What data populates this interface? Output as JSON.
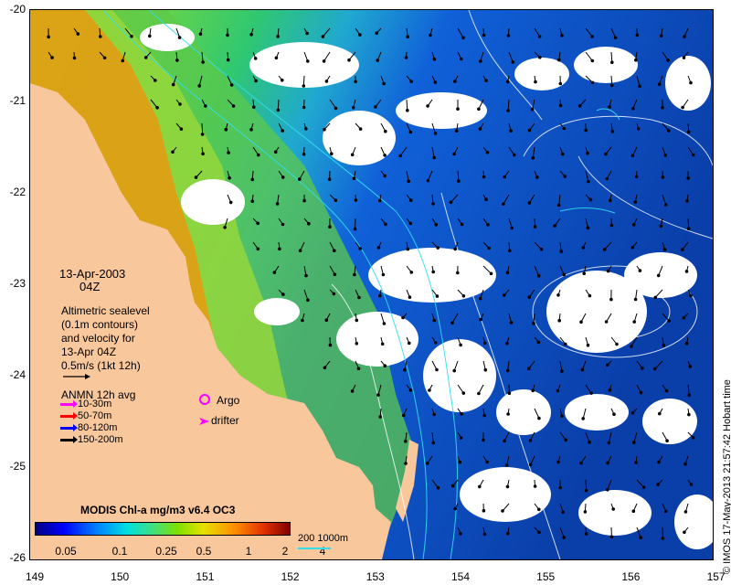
{
  "axes": {
    "y_ticks": [
      "-20",
      "-21",
      "-22",
      "-23",
      "-24",
      "-25",
      "-26"
    ],
    "x_ticks": [
      "149",
      "150",
      "151",
      "152",
      "153",
      "154",
      "155",
      "156",
      "157"
    ]
  },
  "date_block": {
    "date": "13-Apr-2003",
    "time": "04Z"
  },
  "altimetry_text": {
    "line1": "Altimetric sealevel",
    "line2": "(0.1m contours)",
    "line3": "and velocity for",
    "line4": "13-Apr 04Z",
    "line5": "0.5m/s (1kt 12h)"
  },
  "anmn": {
    "title": "ANMN 12h avg",
    "items": [
      {
        "label": "10-30m",
        "color": "#ff00ff"
      },
      {
        "label": "50-70m",
        "color": "#ff0000"
      },
      {
        "label": "80-120m",
        "color": "#0000ff"
      },
      {
        "label": "150-200m",
        "color": "#000000"
      }
    ]
  },
  "argo_label": "Argo",
  "drifter_label": "drifter",
  "argo_color": "#ff00ff",
  "colorbar": {
    "title": "MODIS Chl-a mg/m3 v6.4 OC3",
    "labels": [
      "0.05",
      "0.1",
      "0.25",
      "0.5",
      "1",
      "2",
      "4"
    ]
  },
  "depth_label": "200  1000m",
  "depth_color": "#33ddee",
  "credit": "© IMOS 17-May-2013 21:57:42 Hobart time",
  "colors": {
    "land": "#f9c79c",
    "deep_ocean": "#0a3ea8",
    "cloud": "#ffffff"
  }
}
